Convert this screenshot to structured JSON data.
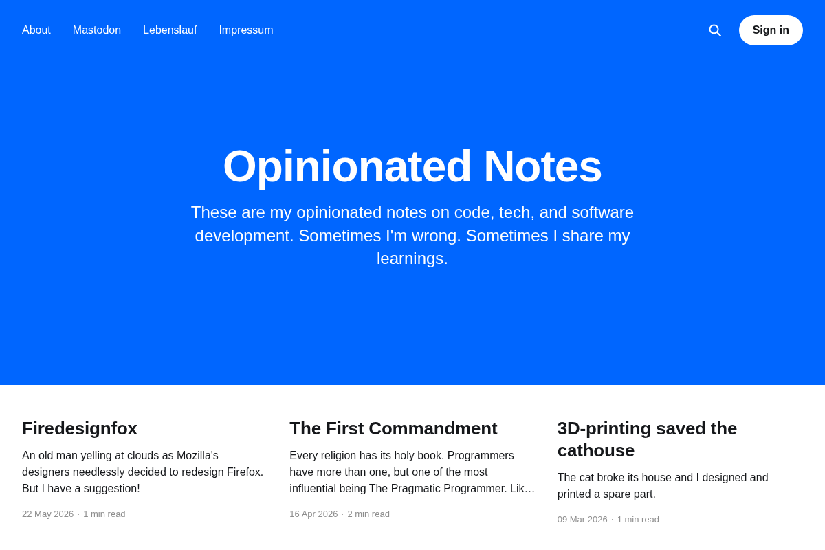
{
  "nav": {
    "links": [
      "About",
      "Mastodon",
      "Lebenslauf",
      "Impressum"
    ],
    "sign_in": "Sign in"
  },
  "hero": {
    "title": "Opinionated Notes",
    "description": "These are my opinionated notes on code, tech, and software development. Sometimes I'm wrong. Sometimes I share my learnings."
  },
  "posts": [
    {
      "title": "Firedesignfox",
      "excerpt": "An old man yelling at clouds as Mozilla's designers needlessly decided to redesign Firefox. But I have a suggestion!",
      "date": "22 May 2026",
      "reading_time": "1 min read"
    },
    {
      "title": "The First Commandment",
      "excerpt": "Every religion has its holy book. Programmers have more than one, but one of the most influential being The Pragmatic Programmer. Lik…",
      "date": "16 Apr 2026",
      "reading_time": "2 min read"
    },
    {
      "title": "3D-printing saved the cathouse",
      "excerpt": "The cat broke its house and I designed and printed a spare part.",
      "date": "09 Mar 2026",
      "reading_time": "1 min read"
    }
  ]
}
